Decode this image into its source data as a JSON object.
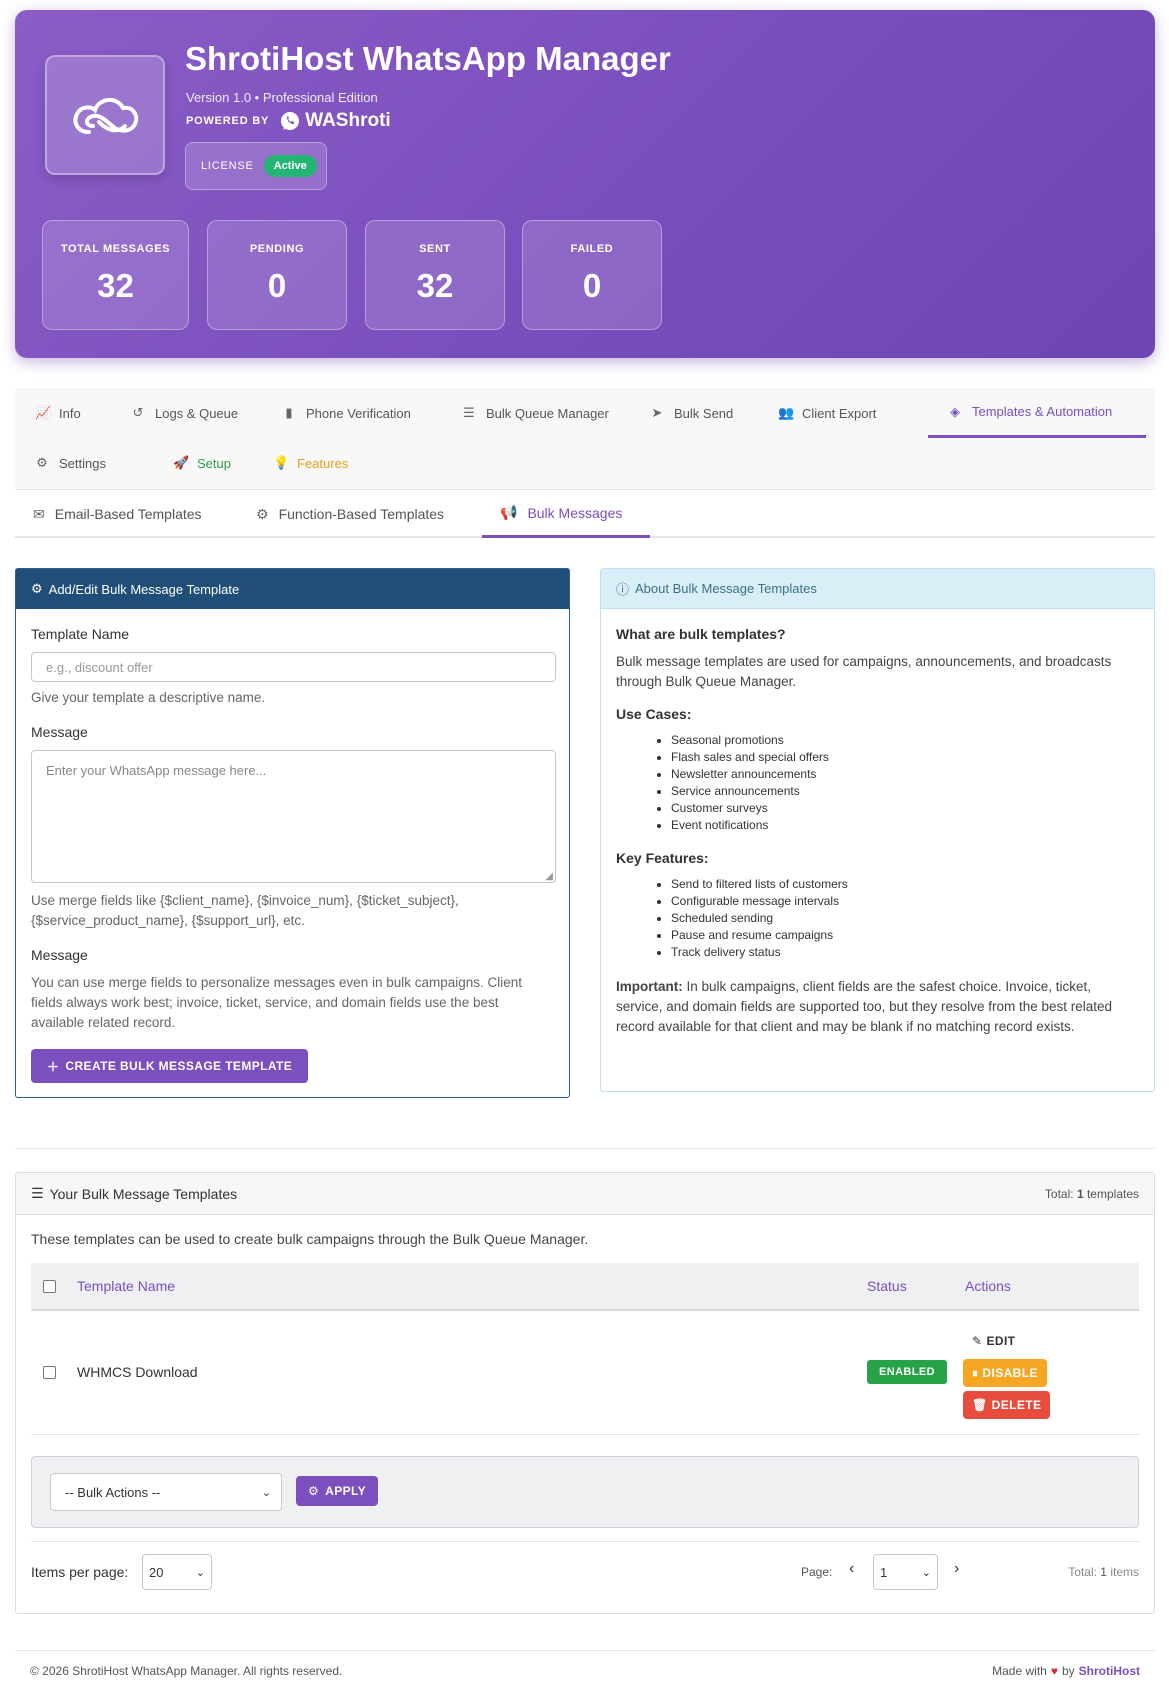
{
  "header": {
    "title": "ShrotiHost WhatsApp Manager",
    "version": "Version 1.0 • Professional Edition",
    "powered_by": "POWERED BY",
    "brand": "WAShroti",
    "license_label": "LICENSE",
    "license_status": "Active",
    "stats": [
      {
        "label": "TOTAL MESSAGES",
        "value": "32"
      },
      {
        "label": "PENDING",
        "value": "0"
      },
      {
        "label": "SENT",
        "value": "32"
      },
      {
        "label": "FAILED",
        "value": "0"
      }
    ]
  },
  "main_tabs": [
    {
      "label": "Info",
      "icon": "chart-line-icon"
    },
    {
      "label": "Logs & Queue",
      "icon": "history-icon"
    },
    {
      "label": "Phone Verification",
      "icon": "mobile-icon"
    },
    {
      "label": "Bulk Queue Manager",
      "icon": "tasks-icon"
    },
    {
      "label": "Bulk Send",
      "icon": "paper-plane-icon"
    },
    {
      "label": "Client Export",
      "icon": "users-icon"
    },
    {
      "label": "Templates & Automation",
      "icon": "layers-icon",
      "active": true
    },
    {
      "label": "Settings",
      "icon": "cogs-icon"
    },
    {
      "label": "Setup",
      "icon": "rocket-icon"
    },
    {
      "label": "Features",
      "icon": "lightbulb-icon"
    }
  ],
  "sub_tabs": [
    {
      "label": "Email-Based Templates",
      "icon": "envelope-icon"
    },
    {
      "label": "Function-Based Templates",
      "icon": "gear-icon"
    },
    {
      "label": "Bulk Messages",
      "icon": "bullhorn-icon",
      "active": true
    }
  ],
  "form": {
    "title": "Add/Edit Bulk Message Template",
    "name_label": "Template Name",
    "name_placeholder": "e.g., discount offer",
    "name_help": "Give your template a descriptive name.",
    "message_label": "Message",
    "message_placeholder": "Enter your WhatsApp message here...",
    "message_help": "Use merge fields like {$client_name}, {$invoice_num}, {$ticket_subject}, {$service_product_name}, {$support_url}, etc.",
    "note_label": "Message",
    "note_text": "You can use merge fields to personalize messages even in bulk campaigns. Client fields always work best; invoice, ticket, service, and domain fields use the best available related record.",
    "submit_label": "CREATE BULK MESSAGE TEMPLATE"
  },
  "about": {
    "title": "About Bulk Message Templates",
    "q1": "What are bulk templates?",
    "p1": "Bulk message templates are used for campaigns, announcements, and broadcasts through Bulk Queue Manager.",
    "use_cases_label": "Use Cases:",
    "use_cases": [
      "Seasonal promotions",
      "Flash sales and special offers",
      "Newsletter announcements",
      "Service announcements",
      "Customer surveys",
      "Event notifications"
    ],
    "features_label": "Key Features:",
    "features": [
      "Send to filtered lists of customers",
      "Configurable message intervals",
      "Scheduled sending",
      "Pause and resume campaigns",
      "Track delivery status"
    ],
    "important_label": "Important:",
    "important_text": "In bulk campaigns, client fields are the safest choice. Invoice, ticket, service, and domain fields are supported too, but they resolve from the best related record available for that client and may be blank if no matching record exists."
  },
  "templates": {
    "title": "Your Bulk Message Templates",
    "total_prefix": "Total:",
    "total_count": "1",
    "total_suffix": "templates",
    "description": "These templates can be used to create bulk campaigns through the Bulk Queue Manager.",
    "columns": {
      "name": "Template Name",
      "status": "Status",
      "actions": "Actions"
    },
    "rows": [
      {
        "name": "WHMCS Download",
        "status": "ENABLED",
        "edit": "EDIT",
        "disable": "DISABLE",
        "delete": "DELETE"
      }
    ],
    "bulk_actions": "-- Bulk Actions --",
    "apply": "APPLY",
    "per_page_label": "Items per page:",
    "per_page": "20",
    "page_label": "Page:",
    "page": "1",
    "total_items_prefix": "Total:",
    "total_items_count": "1",
    "total_items_suffix": "items"
  },
  "footer": {
    "copyright": "© 2026 ShrotiHost WhatsApp Manager. All rights reserved.",
    "made_with": "Made with",
    "by": "by",
    "brand": "ShrotiHost"
  },
  "colors": {
    "primary": "#7b4fbd",
    "header_blue": "#1f4e79",
    "success": "#27a347",
    "warning": "#f5a623",
    "danger": "#e74c3c"
  }
}
